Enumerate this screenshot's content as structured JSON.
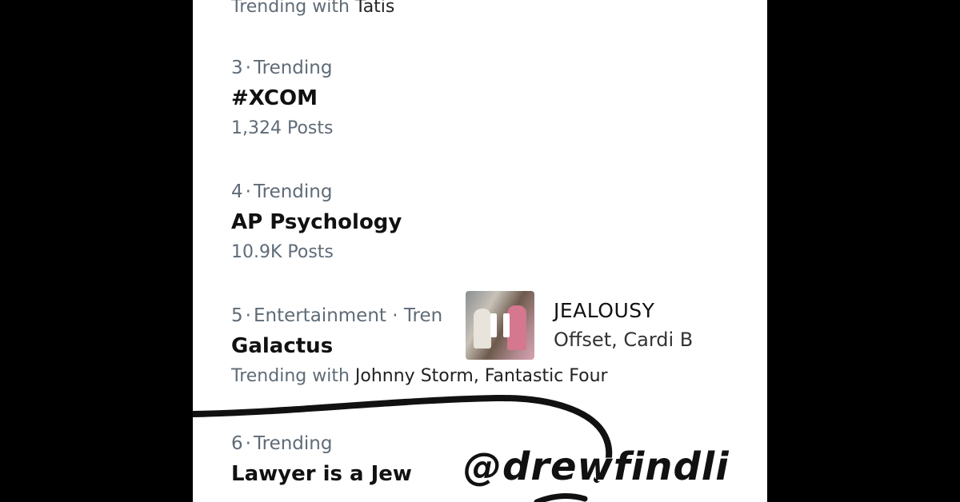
{
  "trends": [
    {
      "context_prefix": "Trending with ",
      "context_names": "Tatis"
    },
    {
      "rank": "3",
      "category": "Trending",
      "title": "#XCOM",
      "count": "1,324 Posts"
    },
    {
      "rank": "4",
      "category": "Trending",
      "title": "AP Psychology",
      "count": "10.9K Posts"
    },
    {
      "rank": "5",
      "category": "Entertainment · Tren",
      "title": "Galactus",
      "context_prefix": "Trending with ",
      "context_names": "Johnny Storm, Fantastic Four"
    },
    {
      "rank": "6",
      "category": "Trending",
      "title": "Lawyer is a Jew"
    }
  ],
  "separator": "·",
  "music_sticker": {
    "title": "JEALOUSY",
    "artist": "Offset, Cardi B",
    "icon": "pause-icon"
  },
  "overlay_handle": "@drewfindli",
  "colors": {
    "background": "#000000",
    "panel": "#ffffff",
    "meta_text": "#5f6b77",
    "title_text": "#111111"
  }
}
